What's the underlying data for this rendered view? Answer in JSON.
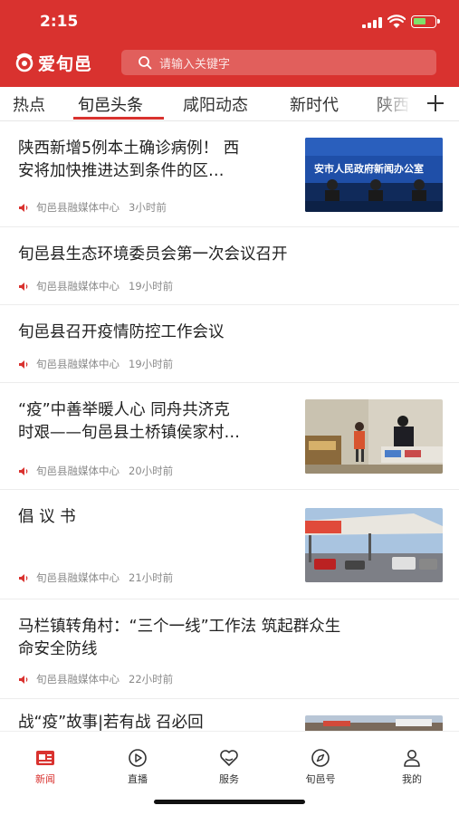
{
  "status_bar": {
    "time": "2:15"
  },
  "app": {
    "logo_text": "爱旬邑",
    "search_placeholder": "请输入关键字"
  },
  "tabs": [
    {
      "label": "热点",
      "active": false
    },
    {
      "label": "旬邑头条",
      "active": true
    },
    {
      "label": "咸阳动态",
      "active": false
    },
    {
      "label": "新时代",
      "active": false
    },
    {
      "label": "陕西",
      "active": false
    }
  ],
  "news": [
    {
      "title_l1": "陕西新增5例本土确诊病例！ 西",
      "title_l2": "安将加快推进达到条件的区…",
      "source": "旬邑县融媒体中心",
      "time": "3小时前",
      "thumb_text": "安市人民政府新闻办公室"
    },
    {
      "title_l1": "旬邑县生态环境委员会第一次会议召开",
      "title_l2": "",
      "source": "旬邑县融媒体中心",
      "time": "19小时前"
    },
    {
      "title_l1": "旬邑县召开疫情防控工作会议",
      "title_l2": "",
      "source": "旬邑县融媒体中心",
      "time": "19小时前"
    },
    {
      "title_l1": "“疫”中善举暖人心 同舟共济克",
      "title_l2": "时艰——旬邑县土桥镇侯家村…",
      "source": "旬邑县融媒体中心",
      "time": "20小时前"
    },
    {
      "title_l1": "倡 议 书",
      "title_l2": "",
      "source": "旬邑县融媒体中心",
      "time": "21小时前"
    },
    {
      "title_l1": "马栏镇转角村：“三个一线”工作法 筑起群众生",
      "title_l2": "命安全防线",
      "source": "旬邑县融媒体中心",
      "time": "22小时前"
    },
    {
      "title_l1": "战“疫”故事|若有战 召必回",
      "title_l2": ""
    }
  ],
  "bottom_nav": [
    {
      "label": "新闻",
      "icon": "news-icon",
      "active": true
    },
    {
      "label": "直播",
      "icon": "live-icon",
      "active": false
    },
    {
      "label": "服务",
      "icon": "service-icon",
      "active": false
    },
    {
      "label": "旬邑号",
      "icon": "compass-icon",
      "active": false
    },
    {
      "label": "我的",
      "icon": "user-icon",
      "active": false
    }
  ],
  "colors": {
    "brand": "#d9322f",
    "meta_text": "#8a8a8a"
  }
}
